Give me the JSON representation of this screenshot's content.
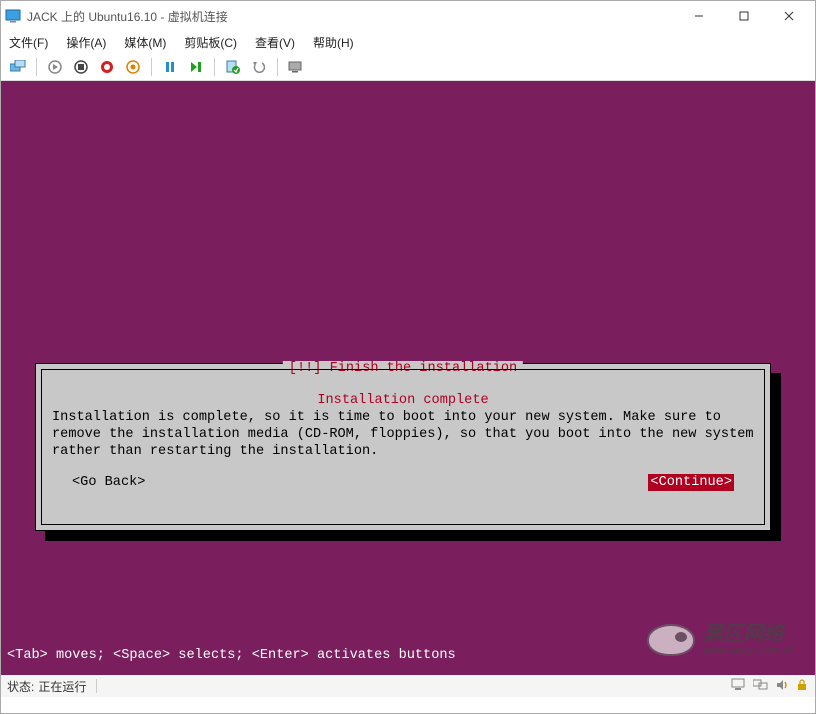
{
  "window": {
    "title": "JACK 上的 Ubuntu16.10 - 虚拟机连接"
  },
  "menu": {
    "file": "文件(F)",
    "action": "操作(A)",
    "media": "媒体(M)",
    "clipboard": "剪贴板(C)",
    "view": "查看(V)",
    "help": "帮助(H)"
  },
  "installer": {
    "box_title": "[!!] Finish the installation",
    "subtitle": "Installation complete",
    "body": "Installation is complete, so it is time to boot into your new system. Make sure to remove the installation media (CD-ROM, floppies), so that you boot into the new system rather than restarting the installation.",
    "go_back": "<Go Back>",
    "continue": "<Continue>"
  },
  "hint": "<Tab> moves; <Space> selects; <Enter> activates buttons",
  "status": {
    "label": "状态:",
    "value": "正在运行"
  },
  "watermark": {
    "line1": "黑区网络",
    "line2": "www.heiqu.com.cn"
  }
}
